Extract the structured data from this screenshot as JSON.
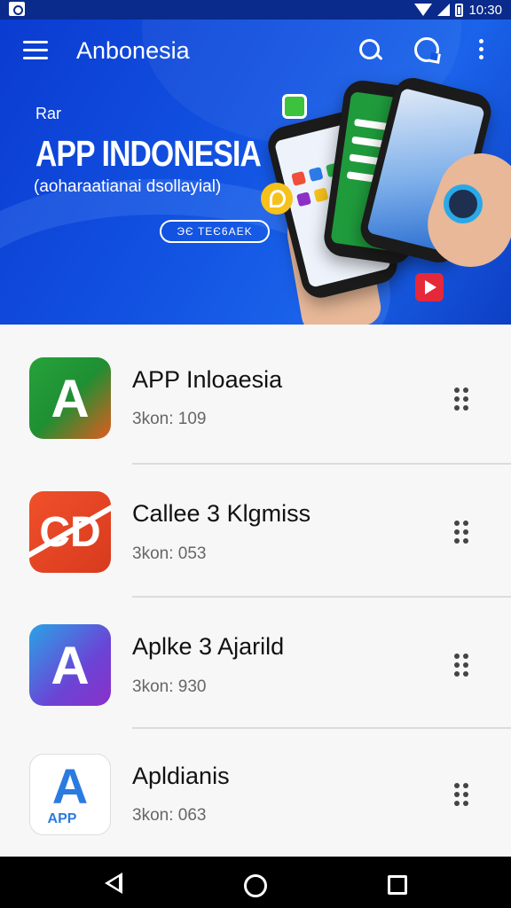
{
  "status_bar": {
    "time": "10:30"
  },
  "app_bar": {
    "title": "Anbonesia"
  },
  "hero": {
    "small_text": "Rar",
    "title": "APP INDONESIA",
    "subtitle": "(aoharaatianai dsollayial)",
    "button_label": "ЭЄ TЕЄ6AEK"
  },
  "apps": [
    {
      "name": "APP Inloaesia",
      "meta": "3kon: 109"
    },
    {
      "name": "Callee 3 Klgmiss",
      "meta": "3kon: 053"
    },
    {
      "name": "Aplke 3 Ajarild",
      "meta": "3kon: 930"
    },
    {
      "name": "Apldianis",
      "meta": "3kon: 063",
      "icon_tag": "APP"
    }
  ],
  "colors": {
    "hero_blue": "#1150e0",
    "status_blue": "#0a2a8c"
  },
  "icons": [
    "hamburger-icon",
    "search-icon",
    "chat-icon",
    "more-vert-icon",
    "drag-handle-icon",
    "back-icon",
    "home-icon",
    "recents-icon"
  ]
}
